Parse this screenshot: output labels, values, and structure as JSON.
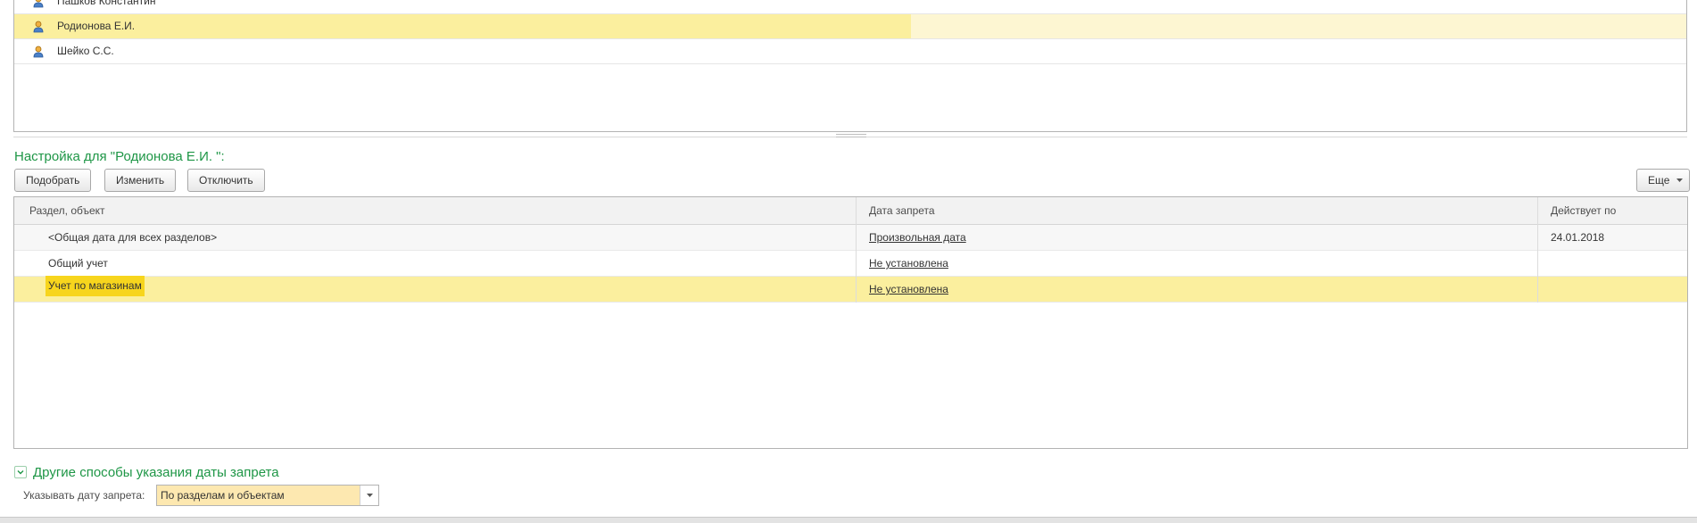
{
  "users": {
    "items": [
      {
        "name": "Пашков Константин",
        "selected": false
      },
      {
        "name": "Родионова Е.И.",
        "selected": true
      },
      {
        "name": "Шейко С.С.",
        "selected": false
      }
    ]
  },
  "settings": {
    "title": "Настройка для \"Родионова Е.И. \":"
  },
  "toolbar": {
    "pick_label": "Подобрать",
    "edit_label": "Изменить",
    "disable_label": "Отключить",
    "more_label": "Еще"
  },
  "table": {
    "columns": [
      "Раздел, объект",
      "Дата запрета",
      "Действует по"
    ],
    "rows": [
      {
        "section": "<Общая дата для всех разделов>",
        "date": "Произвольная дата",
        "valid_until": "24.01.2018"
      },
      {
        "section": "Общий учет",
        "date": "Не установлена",
        "valid_until": ""
      },
      {
        "section": "Учет по магазинам",
        "date": "Не установлена",
        "valid_until": ""
      }
    ]
  },
  "other_methods": {
    "title": "Другие способы указания даты запрета",
    "field_label": "Указывать дату запрета:",
    "field_value": "По разделам и объектам"
  },
  "colors": {
    "accent_green": "#1e9646",
    "selected_row": "#fbef9e",
    "selected_cell": "#f7d51d"
  }
}
